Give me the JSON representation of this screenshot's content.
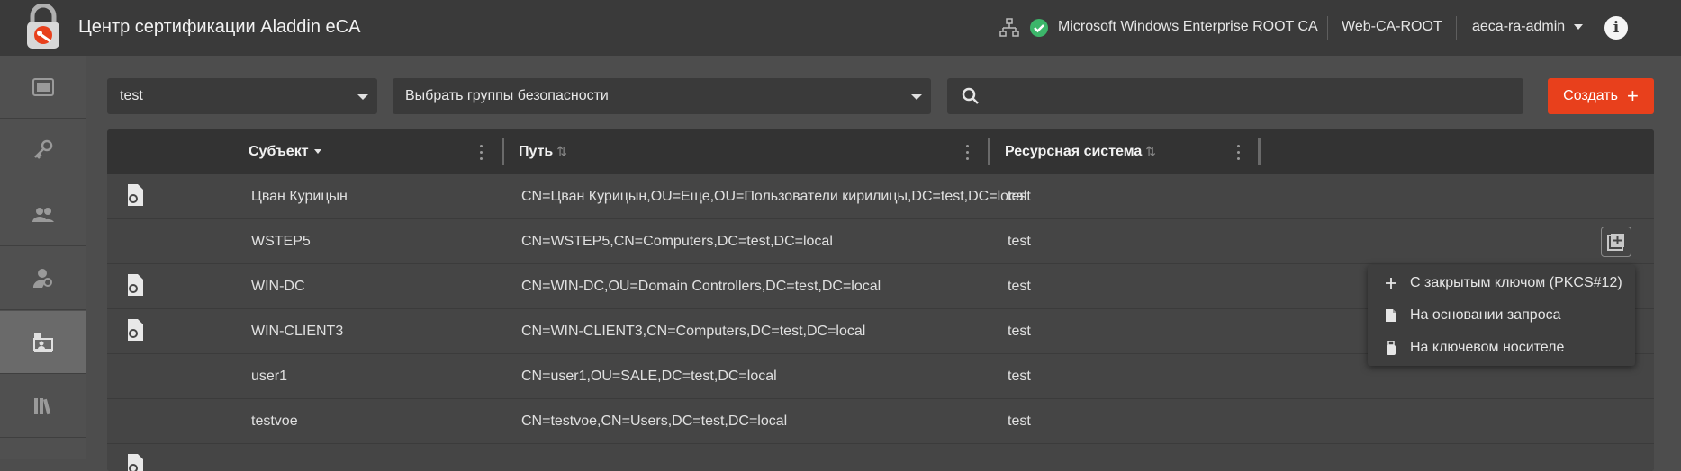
{
  "app": {
    "title": "Центр сертификации Aladdin eCA"
  },
  "header": {
    "ca_name": "Microsoft Windows Enterprise ROOT CA",
    "ca_short": "Web-CA-ROOT",
    "user": "aeca-ra-admin"
  },
  "sidebar": {
    "items": [
      {
        "icon": "certificate-window-icon"
      },
      {
        "icon": "keys-icon"
      },
      {
        "icon": "users-icon"
      },
      {
        "icon": "user-cert-icon"
      },
      {
        "icon": "cert-issuance-icon",
        "active": true
      },
      {
        "icon": "library-icon"
      }
    ]
  },
  "filters": {
    "domain": "test",
    "groups_placeholder": "Выбрать группы безопасности",
    "search_value": "",
    "create_label": "Создать"
  },
  "table": {
    "columns": [
      {
        "label": "Субъект"
      },
      {
        "label": "Путь"
      },
      {
        "label": "Ресурсная система"
      }
    ],
    "rows": [
      {
        "subject": "Цван Курицын",
        "path": "CN=Цван Курицын,OU=Еще,OU=Пользователи кирилицы,DC=test,DC=local",
        "system": "test",
        "has_cert": true
      },
      {
        "subject": "WSTEP5",
        "path": "CN=WSTEP5,CN=Computers,DC=test,DC=local",
        "system": "test",
        "has_cert": false
      },
      {
        "subject": "WIN-DC",
        "path": "CN=WIN-DC,OU=Domain Controllers,DC=test,DC=local",
        "system": "test",
        "has_cert": true
      },
      {
        "subject": "WIN-CLIENT3",
        "path": "CN=WIN-CLIENT3,CN=Computers,DC=test,DC=local",
        "system": "test",
        "has_cert": true
      },
      {
        "subject": "user1",
        "path": "CN=user1,OU=SALE,DC=test,DC=local",
        "system": "test",
        "has_cert": false
      },
      {
        "subject": "testvoe",
        "path": "CN=testvoe,CN=Users,DC=test,DC=local",
        "system": "test",
        "has_cert": false
      }
    ]
  },
  "context_menu": {
    "items": [
      {
        "label": "С закрытым ключом (PKCS#12)",
        "icon": "plus-icon"
      },
      {
        "label": "На основании запроса",
        "icon": "document-icon"
      },
      {
        "label": "На ключевом носителе",
        "icon": "usb-token-icon"
      }
    ]
  },
  "colors": {
    "accent": "#e8401c",
    "ok": "#3cb66a"
  }
}
